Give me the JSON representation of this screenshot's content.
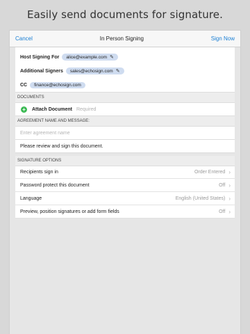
{
  "headline": "Easily send documents for signature.",
  "navbar": {
    "cancel": "Cancel",
    "title": "In Person Signing",
    "sign_now": "Sign Now"
  },
  "recipients": {
    "host": {
      "label": "Host Signing For",
      "email": "alice@example.com"
    },
    "additional": {
      "label": "Additional Signers",
      "email": "sales@echosign.com"
    },
    "cc": {
      "label": "CC",
      "email": "finance@echosign.com"
    }
  },
  "documents": {
    "header": "DOCUMENTS",
    "attach_label": "Attach Document",
    "required": "Required"
  },
  "agreement": {
    "header": "AGREEMENT NAME AND MESSAGE:",
    "name_placeholder": "Enter agreement name",
    "message": "Please review and sign this document."
  },
  "signature_options": {
    "header": "SIGNATURE OPTIONS",
    "items": [
      {
        "label": "Recipients sign in",
        "value": "Order Entered"
      },
      {
        "label": "Password protect this document",
        "value": "Off"
      },
      {
        "label": "Language",
        "value": "English (United States)"
      },
      {
        "label": "Preview, position signatures or add form fields",
        "value": "Off"
      }
    ]
  },
  "colors": {
    "accent": "#1a7fd4",
    "chip": "#cfdcf0",
    "add": "#3cba54"
  }
}
